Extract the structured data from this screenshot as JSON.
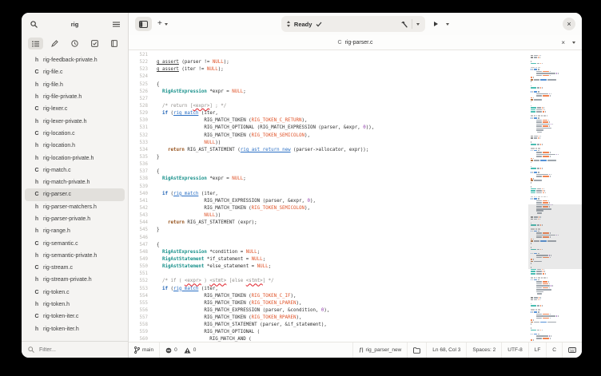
{
  "window": {
    "close_label": "×"
  },
  "sidebar": {
    "title": "rig",
    "filter_placeholder": "Filter...",
    "selected_index": 11,
    "files": [
      {
        "icon": "h",
        "name": "rig-feedback-private.h"
      },
      {
        "icon": "C",
        "name": "rig-file.c"
      },
      {
        "icon": "h",
        "name": "rig-file.h"
      },
      {
        "icon": "h",
        "name": "rig-file-private.h"
      },
      {
        "icon": "C",
        "name": "rig-lexer.c"
      },
      {
        "icon": "h",
        "name": "rig-lexer-private.h"
      },
      {
        "icon": "C",
        "name": "rig-location.c"
      },
      {
        "icon": "h",
        "name": "rig-location.h"
      },
      {
        "icon": "h",
        "name": "rig-location-private.h"
      },
      {
        "icon": "C",
        "name": "rig-match.c"
      },
      {
        "icon": "h",
        "name": "rig-match-private.h"
      },
      {
        "icon": "C",
        "name": "rig-parser.c"
      },
      {
        "icon": "h",
        "name": "rig-parser-matchers.h"
      },
      {
        "icon": "h",
        "name": "rig-parser-private.h"
      },
      {
        "icon": "h",
        "name": "rig-range.h"
      },
      {
        "icon": "C",
        "name": "rig-semantic.c"
      },
      {
        "icon": "h",
        "name": "rig-semantic-private.h"
      },
      {
        "icon": "C",
        "name": "rig-stream.c"
      },
      {
        "icon": "h",
        "name": "rig-stream-private.h"
      },
      {
        "icon": "C",
        "name": "rig-token.c"
      },
      {
        "icon": "h",
        "name": "rig-token.h"
      },
      {
        "icon": "C",
        "name": "rig-token-iter.c"
      },
      {
        "icon": "h",
        "name": "rig-token-iter.h"
      }
    ]
  },
  "toolbar": {
    "new_label": "+",
    "omnibar_status": "Ready"
  },
  "tabbar": {
    "file_icon": "C",
    "filename": "rig-parser.c",
    "close_label": "×"
  },
  "statusbar": {
    "branch": "main",
    "errors": "0",
    "warnings": "0",
    "symbol": "rig_parser_new",
    "position": "Ln 68, Col 3",
    "indent": "Spaces: 2",
    "encoding": "UTF-8",
    "line_ending": "LF",
    "language": "C"
  },
  "colors": {
    "accent": "#1a5fb4",
    "type": "#17908a",
    "constant": "#e0542a",
    "number": "#9141ac",
    "return_kw": "#96521c",
    "comment": "#8f8c88"
  },
  "editor": {
    "lines": [
      {
        "n": 521,
        "s": []
      },
      {
        "n": 522,
        "s": [
          [
            "u",
            "g_assert"
          ],
          [
            "d",
            " (parser != "
          ],
          [
            "c",
            "NULL"
          ],
          [
            "d",
            ");"
          ]
        ]
      },
      {
        "n": 523,
        "s": [
          [
            "u",
            "g_assert"
          ],
          [
            "d",
            " (iter != "
          ],
          [
            "c",
            "NULL"
          ],
          [
            "d",
            ");"
          ]
        ]
      },
      {
        "n": 524,
        "s": []
      },
      {
        "n": 525,
        "s": [
          [
            "d",
            "{"
          ]
        ]
      },
      {
        "n": 526,
        "s": [
          [
            "d",
            "  "
          ],
          [
            "t",
            "RigAstExpression"
          ],
          [
            "d",
            " *expr = "
          ],
          [
            "c",
            "NULL"
          ],
          [
            "d",
            ";"
          ]
        ]
      },
      {
        "n": 527,
        "s": []
      },
      {
        "n": 528,
        "s": [
          [
            "d",
            "  "
          ],
          [
            "m",
            "/* return ["
          ],
          [
            "s",
            "<expr>"
          ],
          [
            "m",
            "] ; */"
          ]
        ]
      },
      {
        "n": 529,
        "s": [
          [
            "d",
            "  "
          ],
          [
            "k",
            "if"
          ],
          [
            "d",
            " ("
          ],
          [
            "f",
            "rig_match"
          ],
          [
            "d",
            " (iter,"
          ]
        ]
      },
      {
        "n": 530,
        "s": [
          [
            "d",
            "                 RIG_MATCH_TOKEN ("
          ],
          [
            "c",
            "RIG_TOKEN_C_RETURN"
          ],
          [
            "d",
            "),"
          ]
        ]
      },
      {
        "n": 531,
        "s": [
          [
            "d",
            "                 RIG_MATCH_OPTIONAL (RIG_MATCH_EXPRESSION (parser, &expr, "
          ],
          [
            "n",
            "0"
          ],
          [
            "d",
            ")),"
          ]
        ]
      },
      {
        "n": 532,
        "s": [
          [
            "d",
            "                 RIG_MATCH_TOKEN ("
          ],
          [
            "c",
            "RIG_TOKEN_SEMICOLON"
          ],
          [
            "d",
            "),"
          ]
        ]
      },
      {
        "n": 533,
        "s": [
          [
            "d",
            "                 "
          ],
          [
            "c",
            "NULL"
          ],
          [
            "d",
            "))"
          ]
        ]
      },
      {
        "n": 534,
        "s": [
          [
            "d",
            "    "
          ],
          [
            "r",
            "return"
          ],
          [
            "d",
            " RIG_AST_STATEMENT ("
          ],
          [
            "f",
            "rig_ast_return_new"
          ],
          [
            "d",
            " (parser->allocator, expr));"
          ]
        ]
      },
      {
        "n": 535,
        "s": [
          [
            "d",
            "}"
          ]
        ]
      },
      {
        "n": 536,
        "s": []
      },
      {
        "n": 537,
        "s": [
          [
            "d",
            "{"
          ]
        ]
      },
      {
        "n": 538,
        "s": [
          [
            "d",
            "  "
          ],
          [
            "t",
            "RigAstExpression"
          ],
          [
            "d",
            " *expr = "
          ],
          [
            "c",
            "NULL"
          ],
          [
            "d",
            ";"
          ]
        ]
      },
      {
        "n": 539,
        "s": []
      },
      {
        "n": 540,
        "s": [
          [
            "d",
            "  "
          ],
          [
            "k",
            "if"
          ],
          [
            "d",
            " ("
          ],
          [
            "f",
            "rig_match"
          ],
          [
            "d",
            " (iter,"
          ]
        ]
      },
      {
        "n": 541,
        "s": [
          [
            "d",
            "                 RIG_MATCH_EXPRESSION (parser, &expr, "
          ],
          [
            "n",
            "0"
          ],
          [
            "d",
            "),"
          ]
        ]
      },
      {
        "n": 542,
        "s": [
          [
            "d",
            "                 RIG_MATCH_TOKEN ("
          ],
          [
            "c",
            "RIG_TOKEN_SEMICOLON"
          ],
          [
            "d",
            "),"
          ]
        ]
      },
      {
        "n": 543,
        "s": [
          [
            "d",
            "                 "
          ],
          [
            "c",
            "NULL"
          ],
          [
            "d",
            "))"
          ]
        ]
      },
      {
        "n": 544,
        "s": [
          [
            "d",
            "    "
          ],
          [
            "r",
            "return"
          ],
          [
            "d",
            " RIG_AST_STATEMENT (expr);"
          ]
        ]
      },
      {
        "n": 545,
        "s": [
          [
            "d",
            "}"
          ]
        ]
      },
      {
        "n": 546,
        "s": []
      },
      {
        "n": 547,
        "s": [
          [
            "d",
            "{"
          ]
        ]
      },
      {
        "n": 548,
        "s": [
          [
            "d",
            "  "
          ],
          [
            "t",
            "RigAstExpression"
          ],
          [
            "d",
            " *condition = "
          ],
          [
            "c",
            "NULL"
          ],
          [
            "d",
            ";"
          ]
        ]
      },
      {
        "n": 549,
        "s": [
          [
            "d",
            "  "
          ],
          [
            "t",
            "RigAstStatement"
          ],
          [
            "d",
            " *if_statement = "
          ],
          [
            "c",
            "NULL"
          ],
          [
            "d",
            ";"
          ]
        ]
      },
      {
        "n": 550,
        "s": [
          [
            "d",
            "  "
          ],
          [
            "t",
            "RigAstStatement"
          ],
          [
            "d",
            " *else_statement = "
          ],
          [
            "c",
            "NULL"
          ],
          [
            "d",
            ";"
          ]
        ]
      },
      {
        "n": 551,
        "s": []
      },
      {
        "n": 552,
        "s": [
          [
            "d",
            "  "
          ],
          [
            "m",
            "/* if ( "
          ],
          [
            "s",
            "<expr>"
          ],
          [
            "m",
            " ) "
          ],
          [
            "s",
            "<stmt>"
          ],
          [
            "m",
            " [else "
          ],
          [
            "s",
            "<stmt>"
          ],
          [
            "m",
            "] */"
          ]
        ]
      },
      {
        "n": 553,
        "s": [
          [
            "d",
            "  "
          ],
          [
            "k",
            "if"
          ],
          [
            "d",
            " ("
          ],
          [
            "f",
            "rig_match"
          ],
          [
            "d",
            " (iter,"
          ]
        ]
      },
      {
        "n": 554,
        "s": [
          [
            "d",
            "                 RIG_MATCH_TOKEN ("
          ],
          [
            "c",
            "RIG_TOKEN_C_IF"
          ],
          [
            "d",
            "),"
          ]
        ]
      },
      {
        "n": 555,
        "s": [
          [
            "d",
            "                 RIG_MATCH_TOKEN ("
          ],
          [
            "c",
            "RIG_TOKEN_LPAREN"
          ],
          [
            "d",
            "),"
          ]
        ]
      },
      {
        "n": 556,
        "s": [
          [
            "d",
            "                 RIG_MATCH_EXPRESSION (parser, &condition, "
          ],
          [
            "n",
            "0"
          ],
          [
            "d",
            "),"
          ]
        ]
      },
      {
        "n": 557,
        "s": [
          [
            "d",
            "                 RIG_MATCH_TOKEN ("
          ],
          [
            "c",
            "RIG_TOKEN_RPAREN"
          ],
          [
            "d",
            "),"
          ]
        ]
      },
      {
        "n": 558,
        "s": [
          [
            "d",
            "                 RIG_MATCH_STATEMENT (parser, &if_statement),"
          ]
        ]
      },
      {
        "n": 559,
        "s": [
          [
            "d",
            "                 RIG_MATCH_OPTIONAL ("
          ]
        ]
      },
      {
        "n": 560,
        "s": [
          [
            "d",
            "                   RIG_MATCH_AND ("
          ]
        ]
      }
    ]
  }
}
